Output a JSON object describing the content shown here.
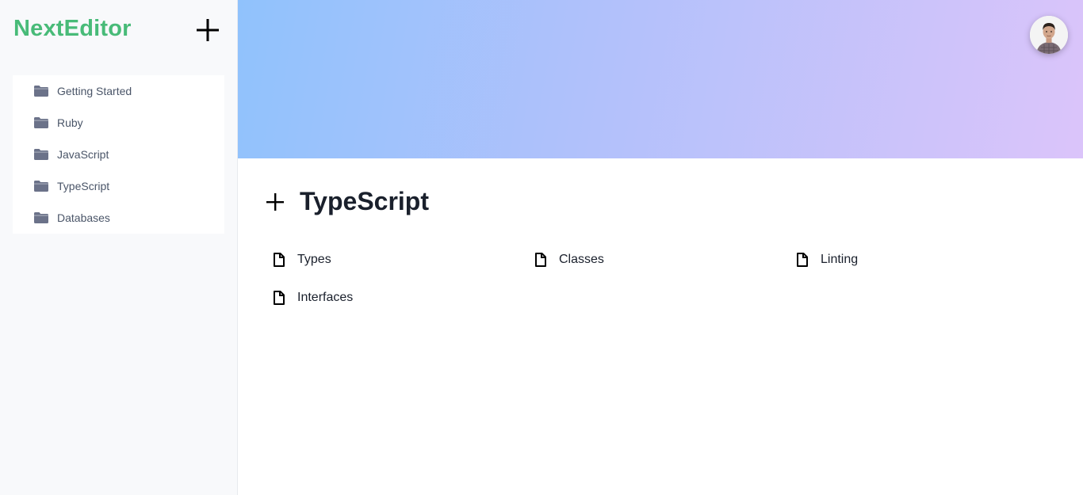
{
  "brand": {
    "name": "NextEditor",
    "color": "#48bb78"
  },
  "sidebar": {
    "add_icon": "plus-icon",
    "folders": [
      {
        "label": "Getting Started",
        "icon": "folder-icon"
      },
      {
        "label": "Ruby",
        "icon": "folder-icon"
      },
      {
        "label": "JavaScript",
        "icon": "folder-icon"
      },
      {
        "label": "TypeScript",
        "icon": "folder-icon"
      },
      {
        "label": "Databases",
        "icon": "folder-icon"
      }
    ]
  },
  "header": {
    "avatar": "user-avatar",
    "banner_colors": [
      "#90c2fc",
      "#b3c1fb",
      "#dbc4fa"
    ]
  },
  "main": {
    "title": "TypeScript",
    "documents": [
      {
        "label": "Types",
        "icon": "file-icon"
      },
      {
        "label": "Classes",
        "icon": "file-icon"
      },
      {
        "label": "Linting",
        "icon": "file-icon"
      },
      {
        "label": "Interfaces",
        "icon": "file-icon"
      }
    ]
  }
}
